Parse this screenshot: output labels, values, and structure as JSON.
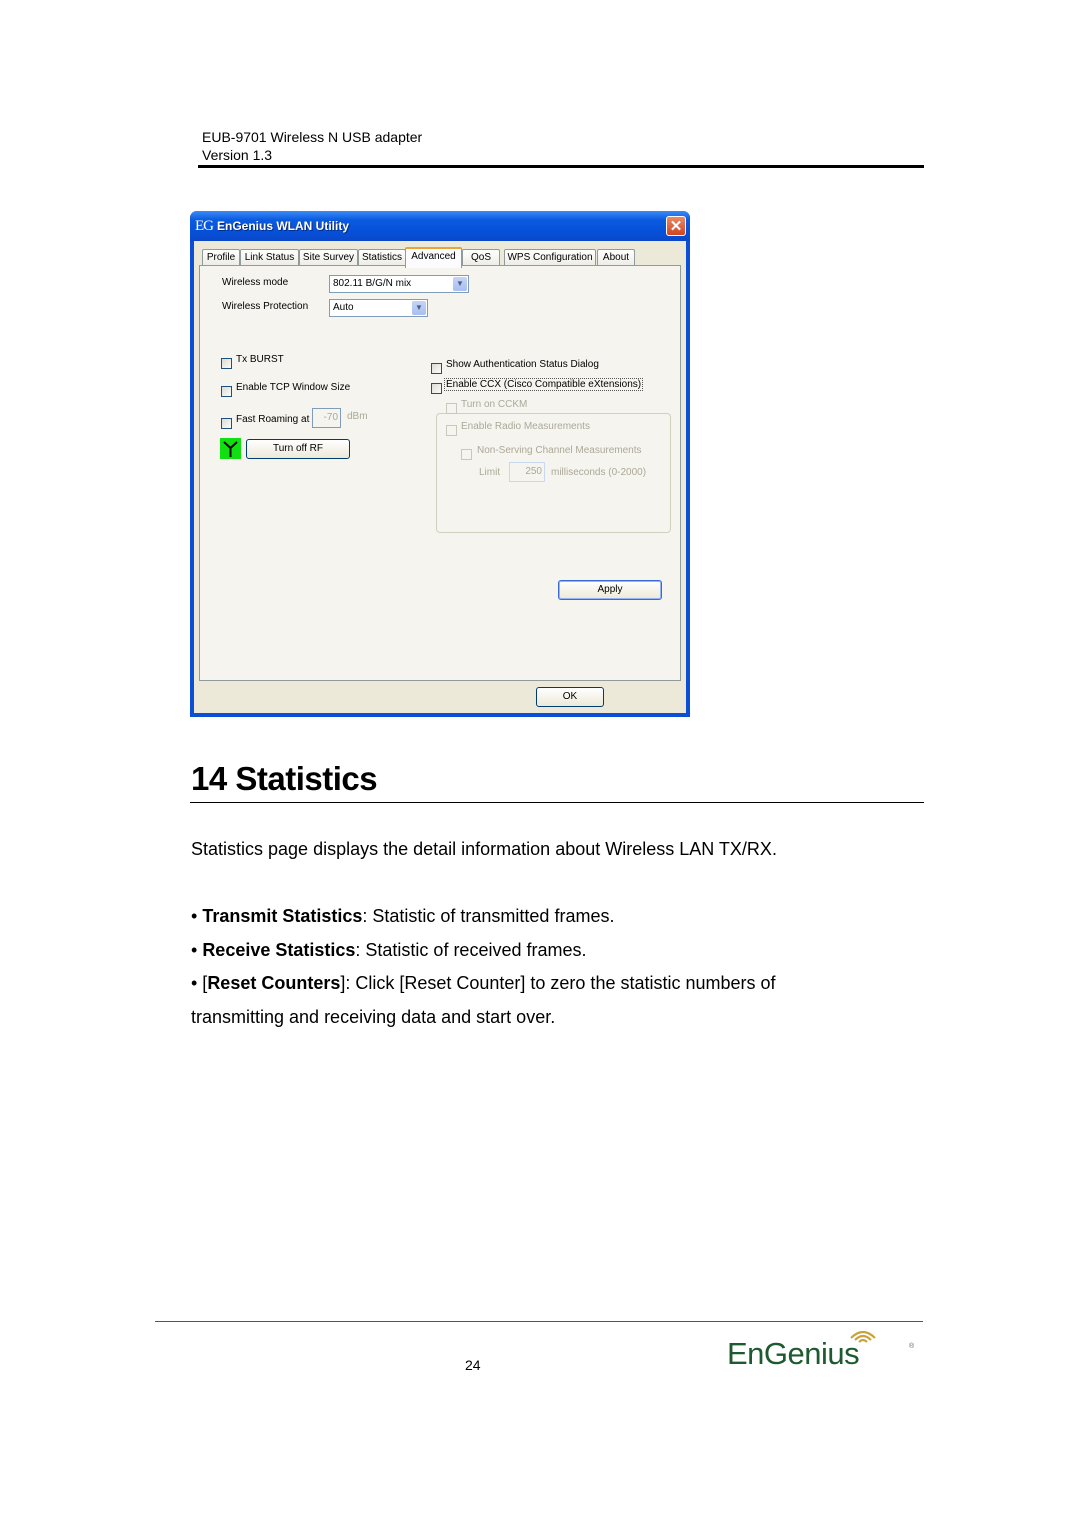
{
  "doc_header": {
    "product": "EUB-9701 Wireless N USB adapter",
    "version": "Version 1.3"
  },
  "window": {
    "logo": "EG",
    "title": "EnGenius WLAN Utility",
    "close_label": "✕",
    "tabs": [
      {
        "label": "Profile"
      },
      {
        "label": "Link Status"
      },
      {
        "label": "Site Survey"
      },
      {
        "label": "Statistics"
      },
      {
        "label": "Advanced",
        "active": true
      },
      {
        "label": "QoS"
      },
      {
        "label": "WPS Configuration"
      },
      {
        "label": "About"
      }
    ],
    "advanced": {
      "wireless_mode_label": "Wireless mode",
      "wireless_mode_value": "802.11 B/G/N mix",
      "wireless_protection_label": "Wireless Protection",
      "wireless_protection_value": "Auto",
      "tx_burst": {
        "label": "Tx BURST",
        "checked": false
      },
      "tcp_window": {
        "label": "Enable TCP Window Size",
        "checked": false
      },
      "fast_roaming": {
        "label": "Fast Roaming at",
        "checked": false,
        "value": "-70",
        "unit": "dBm"
      },
      "turn_off_rf_label": "Turn off RF",
      "show_auth": {
        "label": "Show Authentication Status Dialog",
        "checked": false
      },
      "enable_ccx": {
        "label": "Enable CCX (Cisco Compatible eXtensions)",
        "checked": false
      },
      "turn_on_cckm": {
        "label": "Turn on CCKM",
        "checked": false,
        "disabled": true
      },
      "radio_measurements": {
        "label": "Enable Radio Measurements",
        "checked": false,
        "disabled": true
      },
      "non_serving": {
        "label": "Non-Serving Channel Measurements",
        "checked": false,
        "disabled": true
      },
      "limit_label": "Limit",
      "limit_value": "250",
      "limit_unit": "milliseconds (0-2000)",
      "apply_label": "Apply"
    },
    "ok_label": "OK"
  },
  "section": {
    "title": "14 Statistics",
    "intro": "Statistics page displays the detail information about Wireless LAN TX/RX.",
    "bullets": [
      {
        "prefix": "• ",
        "bold": "Transmit Statistics",
        "text": ": Statistic of transmitted frames."
      },
      {
        "prefix": "• ",
        "bold": "Receive Statistics",
        "text": ": Statistic of received frames."
      },
      {
        "prefix": "• [",
        "bold": "Reset Counters",
        "text": "]: Click [Reset Counter] to zero the statistic numbers of"
      }
    ],
    "continuation": "transmitting and receiving data and start over."
  },
  "footer": {
    "page_number": "24",
    "brand": "EnGenius",
    "brand_mark": "®"
  }
}
